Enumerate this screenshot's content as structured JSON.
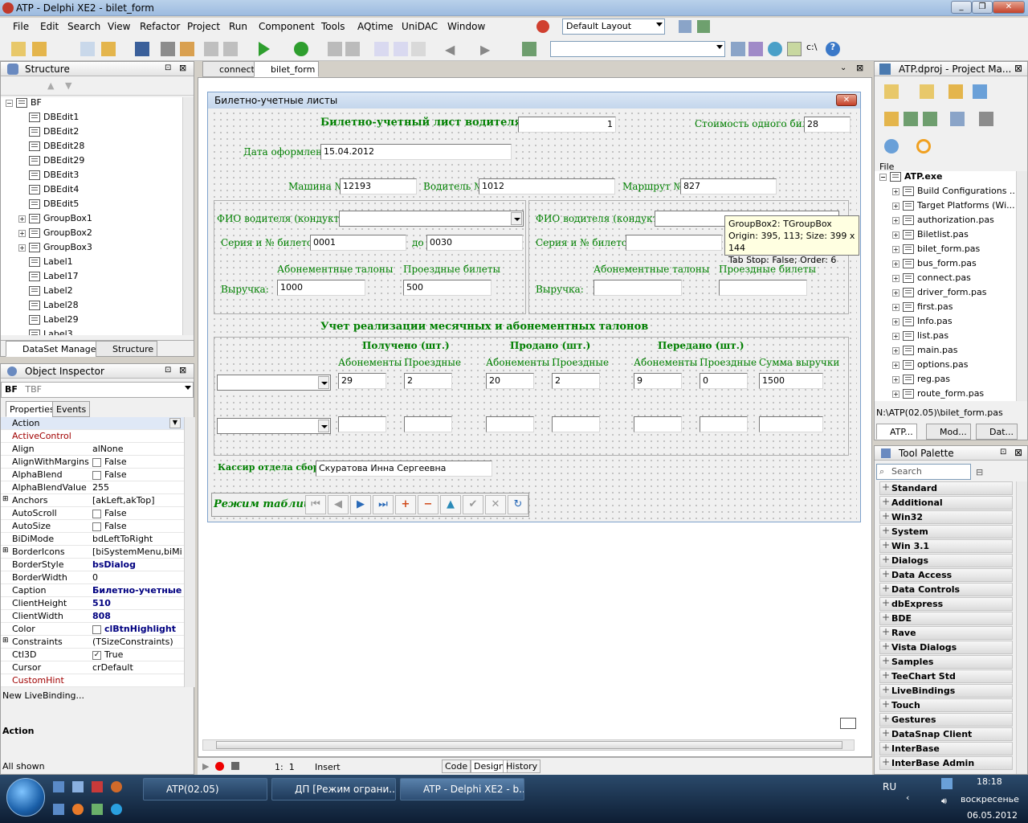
{
  "window": {
    "title": "ATP - Delphi XE2 - bilet_form"
  },
  "menu": [
    "File",
    "Edit",
    "Search",
    "View",
    "Refactor",
    "Project",
    "Run",
    "Component",
    "Tools",
    "AQtime",
    "UniDAC",
    "Window"
  ],
  "toolbar": {
    "layout": "Default Layout"
  },
  "structure": {
    "title": "Structure",
    "root": "BF",
    "items": [
      "DBEdit1",
      "DBEdit2",
      "DBEdit28",
      "DBEdit29",
      "DBEdit3",
      "DBEdit4",
      "DBEdit5",
      "GroupBox1",
      "GroupBox2",
      "GroupBox3",
      "Label1",
      "Label17",
      "Label2",
      "Label28",
      "Label29",
      "Label3"
    ],
    "tabs": [
      "DataSet Manager",
      "Structure"
    ]
  },
  "inspector": {
    "title": "Object Inspector",
    "object": "BF",
    "type": "TBF",
    "tabs": [
      "Properties",
      "Events"
    ],
    "rows": [
      {
        "n": "Action",
        "v": ""
      },
      {
        "n": "ActiveControl",
        "v": "",
        "red": true
      },
      {
        "n": "Align",
        "v": "alNone"
      },
      {
        "n": "AlignWithMargins",
        "v": "False",
        "chk": true
      },
      {
        "n": "AlphaBlend",
        "v": "False",
        "chk": true
      },
      {
        "n": "AlphaBlendValue",
        "v": "255"
      },
      {
        "n": "Anchors",
        "v": "[akLeft,akTop]",
        "plus": true
      },
      {
        "n": "AutoScroll",
        "v": "False",
        "chk": true
      },
      {
        "n": "AutoSize",
        "v": "False",
        "chk": true
      },
      {
        "n": "BiDiMode",
        "v": "bdLeftToRight"
      },
      {
        "n": "BorderIcons",
        "v": "[biSystemMenu,biMinim",
        "plus": true
      },
      {
        "n": "BorderStyle",
        "v": "bsDialog",
        "bold": true
      },
      {
        "n": "BorderWidth",
        "v": "0"
      },
      {
        "n": "Caption",
        "v": "Билетно-учетные л",
        "bold": true
      },
      {
        "n": "ClientHeight",
        "v": "510",
        "bold": true
      },
      {
        "n": "ClientWidth",
        "v": "808",
        "bold": true
      },
      {
        "n": "Color",
        "v": "clBtnHighlight",
        "bold": true,
        "chk": true
      },
      {
        "n": "Constraints",
        "v": "(TSizeConstraints)",
        "plus": true
      },
      {
        "n": "Ctl3D",
        "v": "True",
        "chk": true,
        "checked": true
      },
      {
        "n": "Cursor",
        "v": "crDefault"
      },
      {
        "n": "CustomHint",
        "v": "",
        "red": true
      }
    ],
    "footer_link": "New LiveBinding...",
    "desc": "Action",
    "status": "All shown"
  },
  "editor_tabs": [
    "connect",
    "bilet_form"
  ],
  "form": {
    "caption": "Билетно-учетные листы",
    "header": "Билетно-учетный лист водителя №",
    "sheet_no": "1",
    "ticket_cost_label": "Стоимость одного билета",
    "ticket_cost": "28",
    "date_label": "Дата оформления",
    "date": "15.04.2012",
    "car_label": "Машина №",
    "car": "12193",
    "driver_label": "Водитель №",
    "driver": "1012",
    "route_label": "Маршрут №",
    "route": "827",
    "fio_label": "ФИО водителя (кондуктора)",
    "series_label": "Серия и № билетов с",
    "to_label": "до",
    "series_from": "0001",
    "series_to": "0030",
    "subs_label": "Абонементные талоны",
    "pass_label": "Проездные билеты",
    "revenue_label": "Выручка:",
    "revenue_subs": "1000",
    "revenue_pass": "500",
    "section2": "Учет реализации месячных и абонементных талонов",
    "received": "Получено (шт.)",
    "sold": "Продано (шт.)",
    "transferred": "Передано (шт.)",
    "col_subs": "Абонементы",
    "col_pass": "Проездные",
    "col_sum": "Сумма выручки",
    "row1": [
      "29",
      "2",
      "20",
      "2",
      "9",
      "0",
      "1500"
    ],
    "cashier_label": "Кассир отдела сборов",
    "cashier": "Скуратова Инна Сергеевна",
    "table_mode": "Режим таблицы"
  },
  "tooltip": {
    "l1": "GroupBox2: TGroupBox",
    "l2": "Origin: 395, 113; Size: 399 x 144",
    "l3": "Tab Stop: False; Order: 6"
  },
  "status": {
    "pos": "1:  1",
    "mode": "Insert",
    "tabs": [
      "Code",
      "Design",
      "History"
    ]
  },
  "project": {
    "title": "ATP.dproj - Project Ma...",
    "file_col": "File",
    "root": "ATP.exe",
    "items": [
      "Build Configurations ...",
      "Target Platforms (Wi...",
      "authorization.pas",
      "Biletlist.pas",
      "bilet_form.pas",
      "bus_form.pas",
      "connect.pas",
      "driver_form.pas",
      "first.pas",
      "Info.pas",
      "list.pas",
      "main.pas",
      "options.pas",
      "reg.pas",
      "route_form.pas"
    ],
    "path": "N:\\ATP(02.05)\\bilet_form.pas",
    "tabs": [
      "ATP...",
      "Mod...",
      "Dat..."
    ]
  },
  "palette": {
    "title": "Tool Palette",
    "search": "Search",
    "items": [
      "Standard",
      "Additional",
      "Win32",
      "System",
      "Win 3.1",
      "Dialogs",
      "Data Access",
      "Data Controls",
      "dbExpress",
      "BDE",
      "Rave",
      "Vista Dialogs",
      "Samples",
      "TeeChart Std",
      "LiveBindings",
      "Touch",
      "Gestures",
      "DataSnap Client",
      "InterBase",
      "InterBase Admin"
    ]
  },
  "taskbar": {
    "tasks": [
      "ATP(02.05)",
      "ДП [Режим ограни...",
      "ATP - Delphi XE2 - b..."
    ],
    "lang": "RU",
    "time": "18:18",
    "day": "воскресенье",
    "date": "06.05.2012"
  }
}
